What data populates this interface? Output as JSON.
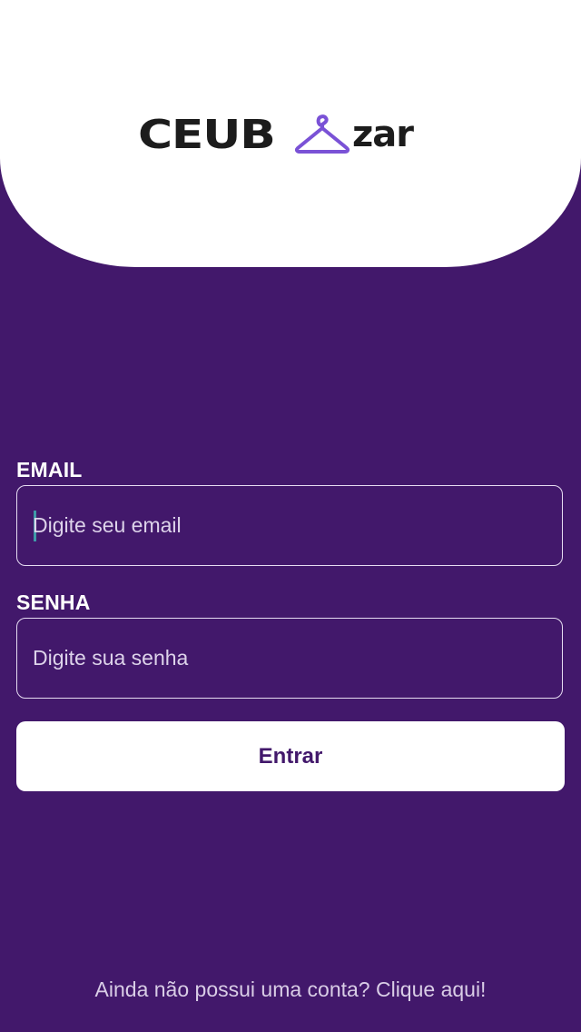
{
  "brand": {
    "logo_part_1": "CEUB",
    "logo_part_2": "zar",
    "logo_icon": "hanger-icon"
  },
  "form": {
    "email": {
      "label": "EMAIL",
      "value": "",
      "placeholder": "Digite seu email"
    },
    "password": {
      "label": "SENHA",
      "value": "",
      "placeholder": "Digite sua senha"
    },
    "submit_label": "Entrar"
  },
  "footer": {
    "signup_text": "Ainda não possui uma conta? Clique aqui!"
  },
  "colors": {
    "background": "#42186b",
    "header": "#ffffff",
    "accent": "#7a52d6",
    "button_text": "#42186b"
  }
}
